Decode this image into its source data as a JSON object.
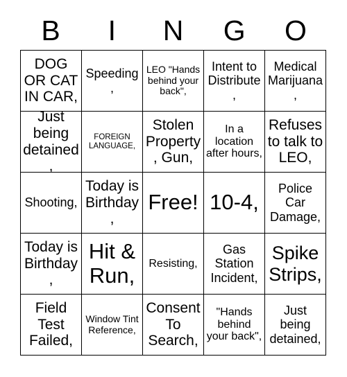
{
  "header": {
    "letters": [
      "B",
      "I",
      "N",
      "G",
      "O"
    ]
  },
  "grid": {
    "rows": 5,
    "columns": 5,
    "border_color": "#000000",
    "background_color": "#ffffff",
    "text_color": "#000000",
    "cells": [
      {
        "text": "DOG OR CAT IN CAR,",
        "size": "fs-l"
      },
      {
        "text": "Speeding,",
        "size": "fs-m"
      },
      {
        "text": "LEO \"Hands behind your back\",",
        "size": "fs-xs"
      },
      {
        "text": "Intent to Distribute,",
        "size": "fs-m"
      },
      {
        "text": "Medical Marijuana,",
        "size": "fs-m"
      },
      {
        "text": "Just being detained,",
        "size": "fs-l"
      },
      {
        "text": "FOREIGN LANGUAGE,",
        "size": "fs-xxs"
      },
      {
        "text": "Stolen Property, Gun,",
        "size": "fs-l"
      },
      {
        "text": "In a location after hours,",
        "size": "fs-s"
      },
      {
        "text": "Refuses to talk to LEO,",
        "size": "fs-l"
      },
      {
        "text": "Shooting,",
        "size": "fs-m"
      },
      {
        "text": "Today is Birthday,",
        "size": "fs-l"
      },
      {
        "text": "Free!",
        "size": "fs-xxl"
      },
      {
        "text": "10-4,",
        "size": "fs-xxl"
      },
      {
        "text": "Police Car Damage,",
        "size": "fs-m"
      },
      {
        "text": "Today is Birthday,",
        "size": "fs-l"
      },
      {
        "text": "Hit & Run,",
        "size": "fs-xxl"
      },
      {
        "text": "Resisting,",
        "size": "fs-s"
      },
      {
        "text": "Gas Station Incident,",
        "size": "fs-m"
      },
      {
        "text": "Spike Strips,",
        "size": "fs-xl"
      },
      {
        "text": "Field Test Failed,",
        "size": "fs-l"
      },
      {
        "text": "Window Tint Reference,",
        "size": "fs-xs"
      },
      {
        "text": "Consent To Search,",
        "size": "fs-l"
      },
      {
        "text": "\"Hands behind your back\",",
        "size": "fs-s"
      },
      {
        "text": "Just being detained,",
        "size": "fs-m"
      }
    ]
  }
}
